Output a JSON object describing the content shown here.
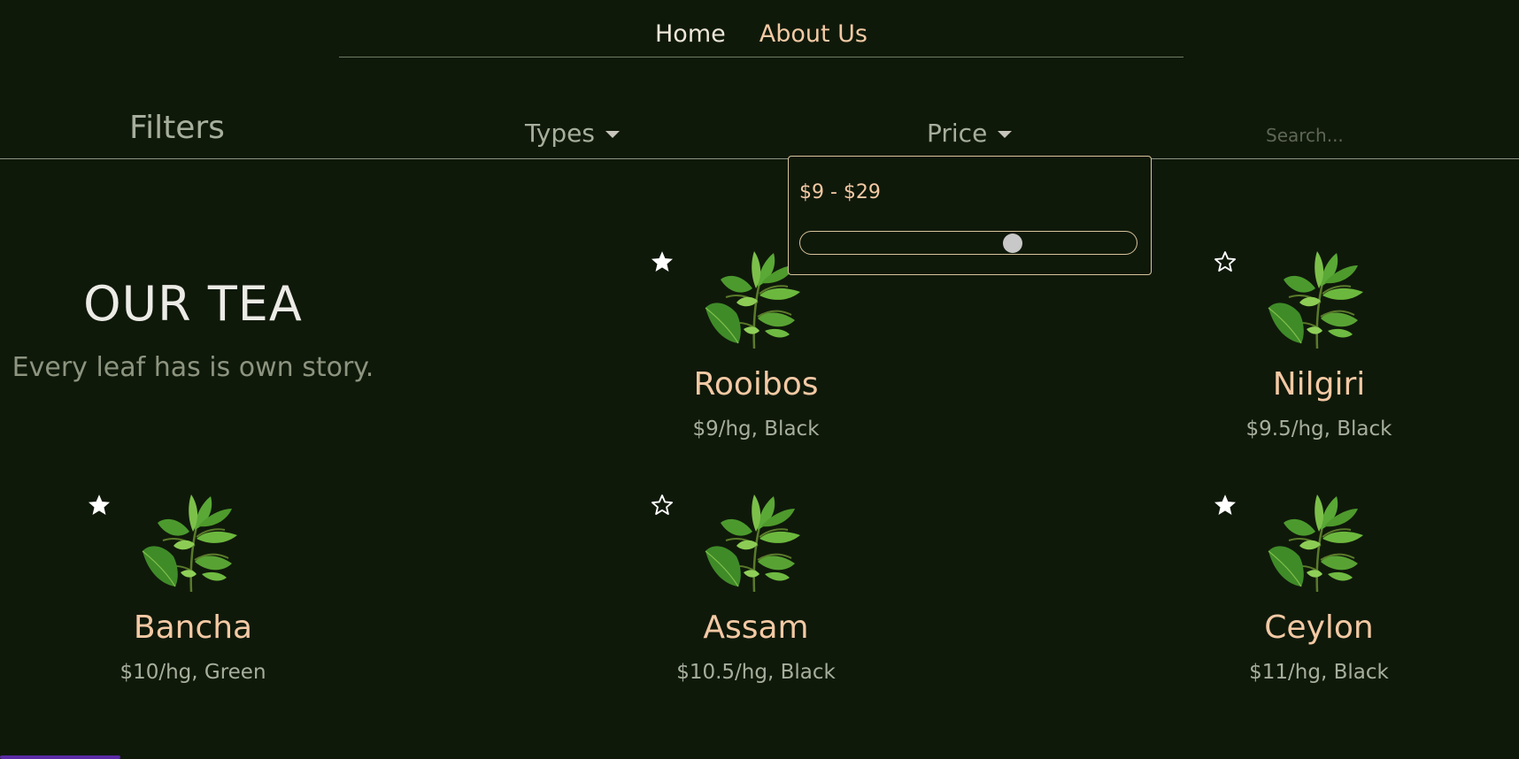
{
  "nav": {
    "home_label": "Home",
    "about_label": "About Us"
  },
  "filters": {
    "title": "Filters",
    "types_label": "Types",
    "price_label": "Price",
    "search_placeholder": "Search..."
  },
  "price_panel": {
    "range_label": "$9 - $29",
    "slider_value_fraction": 0.64
  },
  "hero": {
    "title": "OUR TEA",
    "subtitle": "Every leaf has is own story."
  },
  "teas": [
    {
      "name": "Rooibos",
      "info": "$9/hg, Black",
      "favorite": true,
      "icon": "tea-leaf-icon"
    },
    {
      "name": "Nilgiri",
      "info": "$9.5/hg, Black",
      "favorite": false,
      "icon": "tea-leaf-icon"
    },
    {
      "name": "Bancha",
      "info": "$10/hg, Green",
      "favorite": true,
      "icon": "tea-leaf-icon"
    },
    {
      "name": "Assam",
      "info": "$10.5/hg, Black",
      "favorite": false,
      "icon": "tea-leaf-icon"
    },
    {
      "name": "Ceylon",
      "info": "$11/hg, Black",
      "favorite": true,
      "icon": "tea-leaf-icon"
    }
  ],
  "colors": {
    "background": "#0f190a",
    "accent": "#f3c9a4",
    "muted_text": "#a7ae9c"
  }
}
